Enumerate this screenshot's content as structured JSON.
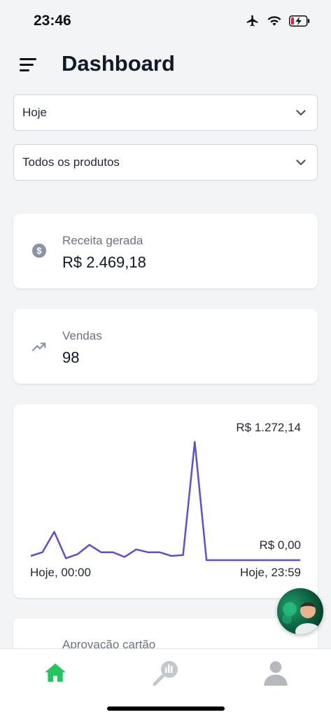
{
  "status": {
    "time": "23:46",
    "icons": [
      "airplane-icon",
      "wifi-icon",
      "battery-charging-icon"
    ]
  },
  "header": {
    "title": "Dashboard",
    "menu_icon": "menu-icon"
  },
  "filters": {
    "period": {
      "value": "Hoje"
    },
    "product": {
      "value": "Todos os produtos"
    }
  },
  "cards": {
    "revenue": {
      "label": "Receita gerada",
      "value": "R$ 2.469,18",
      "icon": "dollar-circle-icon"
    },
    "sales": {
      "label": "Vendas",
      "value": "98",
      "icon": "trending-up-icon"
    },
    "card_approval": {
      "label": "Aprovação cartão"
    }
  },
  "chart": {
    "max_label": "R$ 1.272,14",
    "min_label": "R$ 0,00",
    "x_start_label": "Hoje, 00:00",
    "x_end_label": "Hoje, 23:59"
  },
  "chart_data": {
    "type": "line",
    "ylim": [
      0,
      1272.14
    ],
    "values": [
      45,
      85,
      305,
      20,
      65,
      165,
      85,
      85,
      35,
      115,
      85,
      85,
      45,
      55,
      1272.14,
      0,
      0,
      0,
      0,
      0,
      0,
      0,
      0,
      0
    ],
    "color": "#5b4fd6"
  },
  "bottom_nav": {
    "items": [
      {
        "name": "home",
        "icon": "home-icon",
        "active": true
      },
      {
        "name": "reports",
        "icon": "search-chart-icon",
        "active": false
      },
      {
        "name": "profile",
        "icon": "user-icon",
        "active": false
      }
    ]
  },
  "colors": {
    "accent": "#22c55e",
    "line": "#5b4fd6",
    "muted": "#9ca3af"
  }
}
